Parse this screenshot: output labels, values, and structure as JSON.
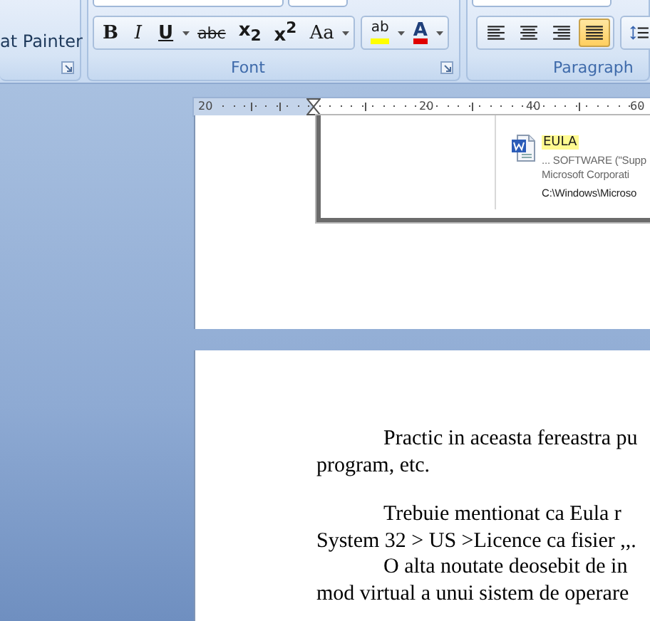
{
  "ribbon": {
    "clipboard": {
      "format_painter_label": "at Painter"
    },
    "font": {
      "label": "Font",
      "buttons": [
        {
          "kind": "bold",
          "text": "B"
        },
        {
          "kind": "italic",
          "text": "I"
        },
        {
          "kind": "underline",
          "text": "U"
        },
        {
          "kind": "strike",
          "text": "abc"
        },
        {
          "kind": "sub",
          "text": "x$_{2}$"
        },
        {
          "kind": "sup",
          "text": "x$^{2}$"
        },
        {
          "kind": "case",
          "text": "Aa"
        },
        {
          "kind": "highlight",
          "text": "ab",
          "color": "#ffff00"
        },
        {
          "kind": "fontcolor",
          "text": "A",
          "color": "#e00000"
        }
      ]
    },
    "paragraph": {
      "label": "Paragraph",
      "buttons": [
        {
          "kind": "left",
          "selected": false
        },
        {
          "kind": "center",
          "selected": false
        },
        {
          "kind": "right",
          "selected": false
        },
        {
          "kind": "justify",
          "selected": true
        },
        {
          "kind": "spacing",
          "selected": false
        }
      ]
    }
  },
  "ruler": {
    "labels": [
      "20",
      "20",
      "40",
      "60"
    ]
  },
  "embedded_screenshot": {
    "result": {
      "title": "EULA",
      "snippet": "... SOFTWARE (\"Supp",
      "publisher": "Microsoft Corporati",
      "path": "C:\\Windows\\Microso"
    }
  },
  "page": {
    "paragraphs": [
      {
        "kind": "indent",
        "lines": [
          "Practic in aceasta fereastra pu",
          "program, etc."
        ]
      },
      {
        "kind": "gap"
      },
      {
        "kind": "indent",
        "lines": [
          "Trebuie mentionat ca Eula r",
          "System 32 > US >Licence ca fisier ,,."
        ]
      },
      {
        "kind": "indent",
        "lines": [
          "O alta noutate deosebit de in",
          "mod virtual a unui sistem de operare"
        ]
      }
    ]
  }
}
